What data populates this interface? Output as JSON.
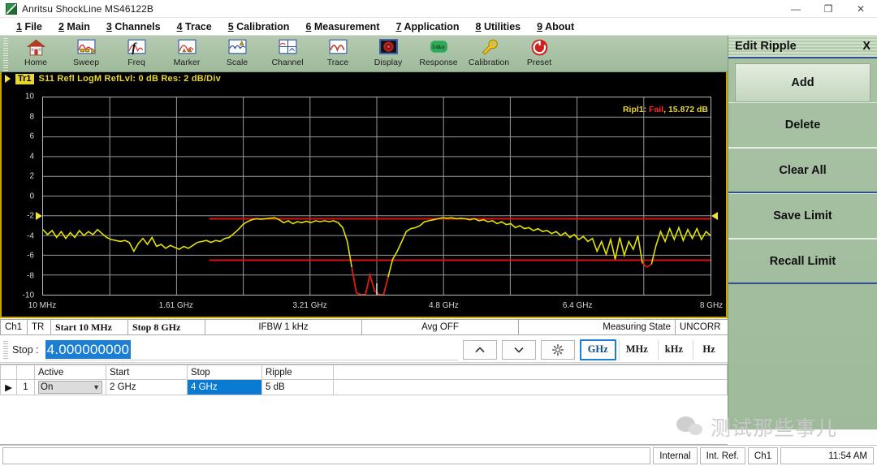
{
  "window": {
    "title": "Anritsu ShockLine MS46122B",
    "app_icon": "anritsu-logo-icon",
    "controls": {
      "minimize": "—",
      "maximize": "❐",
      "close": "✕"
    }
  },
  "menubar": [
    {
      "accel": "1",
      "label": "File"
    },
    {
      "accel": "2",
      "label": "Main"
    },
    {
      "accel": "3",
      "label": "Channels"
    },
    {
      "accel": "4",
      "label": "Trace"
    },
    {
      "accel": "5",
      "label": "Calibration"
    },
    {
      "accel": "6",
      "label": "Measurement"
    },
    {
      "accel": "7",
      "label": "Application"
    },
    {
      "accel": "8",
      "label": "Utilities"
    },
    {
      "accel": "9",
      "label": "About"
    }
  ],
  "toolbar": [
    {
      "label": "Home",
      "icon": "home-icon"
    },
    {
      "label": "Sweep",
      "icon": "sweep-icon"
    },
    {
      "label": "Freq",
      "icon": "freq-function-icon"
    },
    {
      "label": "Marker",
      "icon": "marker-icon"
    },
    {
      "label": "Scale",
      "icon": "scale-icon"
    },
    {
      "label": "Channel",
      "icon": "channel-icon"
    },
    {
      "label": "Trace",
      "icon": "trace-icon"
    },
    {
      "label": "Display",
      "icon": "display-icon"
    },
    {
      "label": "Response",
      "icon": "response-icon"
    },
    {
      "label": "Calibration",
      "icon": "calibration-wrench-icon"
    },
    {
      "label": "Preset",
      "icon": "preset-reset-icon"
    }
  ],
  "chart_data": {
    "type": "line",
    "title": "S11 Refl LogM RefLvl: 0  dB Res: 2  dB/Div",
    "trace_id": "Tr1",
    "annotation": {
      "prefix": "Ripl1:",
      "status": "Fail",
      "value": "15.872 dB"
    },
    "xlabel": "",
    "ylabel": "",
    "ylim": [
      -10,
      10
    ],
    "yticks": [
      10,
      8,
      6,
      4,
      2,
      0,
      -2,
      -4,
      -6,
      -8,
      -10
    ],
    "xticks": [
      "10 MHz",
      "1.61 GHz",
      "3.21 GHz",
      "4.8 GHz",
      "6.4 GHz",
      "8 GHz"
    ],
    "xlim_hz": [
      10000000,
      8000000000
    ],
    "grid": true,
    "legend": "none",
    "trace_color": "#e3e300",
    "limit_color": "#e01010",
    "limit_lines": [
      {
        "name": "upper-ripple-limit",
        "x_start_ghz": 2.0,
        "x_stop_ghz": 8.0,
        "y_db": -2.3
      },
      {
        "name": "lower-ripple-limit",
        "x_start_ghz": 2.0,
        "x_stop_ghz": 8.0,
        "y_db": -6.5
      }
    ],
    "series": [
      {
        "name": "S11 Refl LogM",
        "color": "#e3e300",
        "values": [
          -3.4,
          -3.9,
          -3.5,
          -4.2,
          -3.6,
          -4.3,
          -3.7,
          -4.2,
          -3.5,
          -4.0,
          -3.6,
          -3.9,
          -3.4,
          -3.8,
          -4.2,
          -4.4,
          -4.5,
          -4.6,
          -4.5,
          -4.7,
          -5.6,
          -4.8,
          -4.3,
          -4.9,
          -4.2,
          -5.1,
          -4.9,
          -5.3,
          -5.0,
          -5.2,
          -5.4,
          -5.1,
          -5.3,
          -5.0,
          -4.7,
          -4.6,
          -4.5,
          -4.7,
          -4.5,
          -4.6,
          -4.3,
          -4.2,
          -3.8,
          -3.4,
          -2.9,
          -2.6,
          -2.4,
          -2.3,
          -2.35,
          -2.3,
          -2.25,
          -2.2,
          -2.4,
          -2.7,
          -2.5,
          -2.8,
          -2.6,
          -2.7,
          -2.55,
          -2.7,
          -2.5,
          -2.6,
          -2.5,
          -2.6,
          -2.5,
          -2.7,
          -3.2,
          -4.6,
          -7.2,
          -9.8,
          -11.0,
          -10.2,
          -8.0,
          -9.6,
          -11.0,
          -10.6,
          -8.2,
          -6.4,
          -5.6,
          -4.6,
          -3.6,
          -3.3,
          -3.2,
          -3.0,
          -2.6,
          -2.5,
          -2.4,
          -2.3,
          -2.2,
          -2.25,
          -2.2,
          -2.3,
          -2.25,
          -2.3,
          -2.4,
          -2.3,
          -2.5,
          -2.4,
          -2.6,
          -2.5,
          -2.8,
          -2.6,
          -2.9,
          -2.8,
          -3.2,
          -3.0,
          -3.3,
          -3.2,
          -3.5,
          -3.3,
          -3.6,
          -3.5,
          -3.8,
          -3.6,
          -4.0,
          -3.7,
          -4.2,
          -3.9,
          -4.4,
          -4.1,
          -4.6,
          -4.3,
          -5.6,
          -4.6,
          -5.9,
          -4.4,
          -6.4,
          -4.2,
          -6.0,
          -4.6,
          -5.4,
          -4.0,
          -6.8,
          -7.2,
          -6.9,
          -5.0,
          -3.6,
          -4.6,
          -3.3,
          -4.4,
          -3.2,
          -4.5,
          -3.4,
          -4.3,
          -3.3,
          -4.4,
          -3.6,
          -4.0
        ]
      }
    ]
  },
  "channel_status": {
    "channel": "Ch1",
    "trace": "TR",
    "start": "Start 10 MHz",
    "stop": "Stop 8 GHz",
    "ifbw": "IFBW 1 kHz",
    "avg": "Avg OFF",
    "state": "Measuring State",
    "corr": "UNCORR"
  },
  "entry_bar": {
    "label": "Stop :",
    "value": "4.000000000",
    "placeholder": "",
    "up_icon": "chevron-up-icon",
    "down_icon": "chevron-down-icon",
    "settings_icon": "gear-icon",
    "units": [
      "GHz",
      "MHz",
      "kHz",
      "Hz"
    ],
    "active_unit": "GHz"
  },
  "ripple_table": {
    "columns": [
      "",
      "",
      "Active",
      "Start",
      "Stop",
      "Ripple"
    ],
    "rows": [
      {
        "marker": "▶",
        "index": "1",
        "active": "On",
        "start": "2 GHz",
        "stop": "4 GHz",
        "ripple": "5 dB",
        "selected_cell": "stop"
      }
    ]
  },
  "side_panel": {
    "title": "Edit Ripple",
    "close_label": "X",
    "buttons": [
      "Add",
      "Delete",
      "Clear All",
      "Save Limit",
      "Recall Limit"
    ]
  },
  "bottom_bar": {
    "source": "Internal",
    "reference": "Int. Ref.",
    "channel": "Ch1",
    "time": "11:54 AM"
  },
  "watermark": {
    "text": "测试那些事儿",
    "logo": "wechat-icon"
  },
  "colors": {
    "accent_green": "#a9c2a5",
    "trace_yellow": "#e3e300",
    "limit_red": "#e01010",
    "select_blue": "#0b7ad1",
    "fail_red": "#ff2a2a"
  }
}
